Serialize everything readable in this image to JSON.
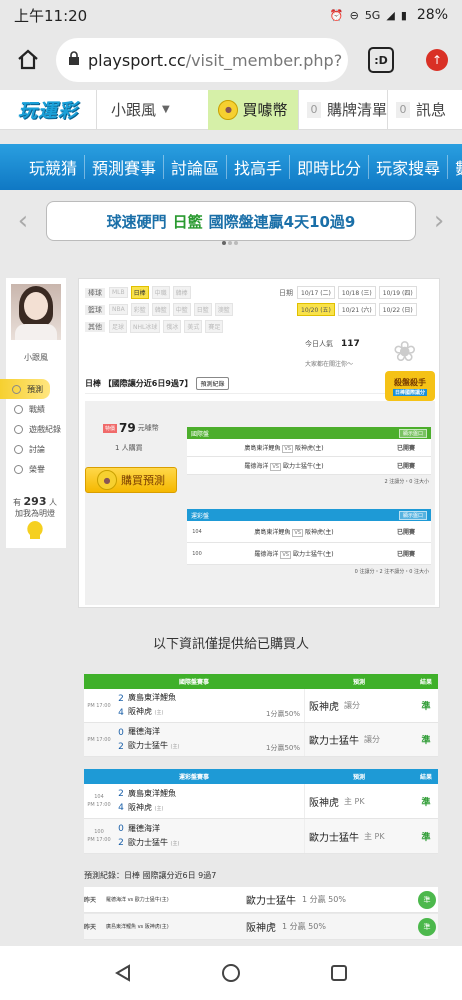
{
  "status": {
    "time": "上午11:20",
    "network": "5G",
    "battery": "28%"
  },
  "browser": {
    "url_domain": "playsport.cc",
    "url_path": "/visit_member.php?",
    "tab_label": ":D"
  },
  "header": {
    "logo": "玩運彩",
    "user": "小跟風",
    "buy_coin": "買噱幣",
    "cart_count": "0",
    "cart_label": "購牌清單",
    "msg_count": "0",
    "msg_label": "訊息"
  },
  "nav": {
    "items": [
      "玩競猜",
      "預測賽事",
      "討論區",
      "找高手",
      "即時比分",
      "玩家搜尋",
      "數據"
    ]
  },
  "banner": {
    "part1": "球速硬門",
    "part2": "日籃",
    "part3": "國際盤連贏4天10過9"
  },
  "profile": {
    "name": "小跟風",
    "menu": [
      "預測",
      "戰績",
      "遊戲紀錄",
      "討論",
      "榮譽"
    ],
    "fans_prefix": "有",
    "fans_count": "293",
    "fans_unit": "人",
    "fans_label": "加我為明燈"
  },
  "filters": {
    "rows": [
      {
        "label": "棒球",
        "chips": [
          "MLB",
          "日棒",
          "中職",
          "韓棒"
        ],
        "selected": 1
      },
      {
        "label": "籃球",
        "chips": [
          "NBA",
          "彩籃",
          "韓籃",
          "中籃",
          "日籃",
          "澳籃"
        ],
        "selected": -1
      },
      {
        "label": "其他",
        "chips": [
          "足球",
          "NHL冰球",
          "俄冰",
          "美式",
          "賽足"
        ],
        "selected": -1
      }
    ],
    "date_label": "日期",
    "dates_row1": [
      "10/17 (二)",
      "10/18 (三)",
      "10/19 (四)"
    ],
    "dates_row2": [
      "10/20 (五)",
      "10/21 (六)",
      "10/22 (日)"
    ]
  },
  "popularity": {
    "label": "今日人氣",
    "value": "117",
    "watching": "大家都在關注你～"
  },
  "pred": {
    "title": "日棒 【國際讓分近6日9過7】",
    "record_btn": "預測紀錄",
    "badge_main": "殺盤殺手",
    "badge_sub": "日棒國際讓分"
  },
  "purchase": {
    "price_tag": "特價",
    "price": "79",
    "price_unit": "元噱幣",
    "buyers": "1 人購買",
    "buy_btn": "購買預測"
  },
  "intl_box": {
    "title": "國際盤",
    "toggle": "顯示盤口",
    "rows": [
      {
        "away": "廣島東洋鯉魚",
        "home": "阪神虎(主)",
        "status": "已開賽"
      },
      {
        "away": "羅德海洋",
        "home": "歐力士猛牛(主)",
        "status": "已開賽"
      }
    ],
    "note": "2 注讓分・0 注大小"
  },
  "tw_box": {
    "title": "運彩盤",
    "toggle": "顯示盤口",
    "rows": [
      {
        "num": "104",
        "away": "廣島東洋鯉魚",
        "home": "阪神虎(主)",
        "status": "已開賽"
      },
      {
        "num": "100",
        "away": "羅德海洋",
        "home": "歐力士猛牛(主)",
        "status": "已開賽"
      }
    ],
    "note": "0 注讓分・2 注不讓分・0 注大小"
  },
  "section_title": "以下資訊僅提供給已購買人",
  "intl_table": {
    "col_game": "國際盤賽事",
    "col_pred": "預測",
    "col_res": "結果",
    "rows": [
      {
        "time": "PM 17:00",
        "s1": "2",
        "s2": "4",
        "t1": "廣島東洋鯉魚",
        "t2": "阪神虎",
        "t2tag": "(主)",
        "spread": "1分贏50%",
        "pick": "阪神虎",
        "ptype": "讓分",
        "res": "準"
      },
      {
        "time": "PM 17:00",
        "s1": "0",
        "s2": "2",
        "t1": "羅德海洋",
        "t2": "歐力士猛牛",
        "t2tag": "(主)",
        "spread": "1分贏50%",
        "pick": "歐力士猛牛",
        "ptype": "讓分",
        "res": "準"
      }
    ]
  },
  "tw_table": {
    "col_game": "運彩盤賽事",
    "col_pred": "預測",
    "col_res": "結果",
    "rows": [
      {
        "num": "104",
        "time": "PM 17:00",
        "s1": "2",
        "s2": "4",
        "t1": "廣島東洋鯉魚",
        "t2": "阪神虎",
        "t2tag": "(主)",
        "pick": "阪神虎",
        "ptype": "主 PK",
        "res": "準"
      },
      {
        "num": "100",
        "time": "PM 17:00",
        "s1": "0",
        "s2": "2",
        "t1": "羅德海洋",
        "t2": "歐力士猛牛",
        "t2tag": "(主)",
        "pick": "歐力士猛牛",
        "ptype": "主 PK",
        "res": "準"
      }
    ]
  },
  "records": {
    "title": "預測紀錄：日棒 國際讓分近6日 9過7",
    "rows": [
      {
        "day": "昨天",
        "match": "羅德海洋 vs 歐力士猛牛(主)",
        "pick": "歐力士猛牛",
        "detail": "1 分贏 50%",
        "res": "準"
      },
      {
        "day": "昨天",
        "match": "廣島東洋鯉魚 vs 阪神虎(主)",
        "pick": "阪神虎",
        "detail": "1 分贏 50%",
        "res": "準"
      }
    ]
  }
}
